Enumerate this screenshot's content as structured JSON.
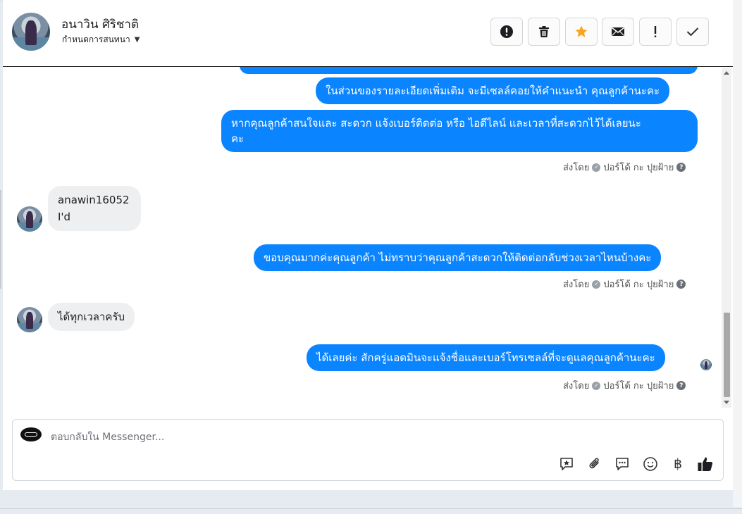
{
  "header": {
    "contact_name": "อนาวิน ศิริชาติ",
    "assign_label": "กำหนดการสนทนา",
    "toolbar": [
      {
        "name": "spam-report-button",
        "icon": "exclamation-circle-icon"
      },
      {
        "name": "delete-button",
        "icon": "trash-icon"
      },
      {
        "name": "star-button",
        "icon": "star-icon"
      },
      {
        "name": "mark-unread-button",
        "icon": "envelope-icon"
      },
      {
        "name": "follow-up-button",
        "icon": "exclamation-icon"
      },
      {
        "name": "mark-done-button",
        "icon": "check-icon"
      }
    ],
    "colors": {
      "star": "#f5a623",
      "text": "#1c1e21"
    }
  },
  "messages": {
    "out1": "ในส่วนของรายละเอียดเพิ่มเติม จะมีเซลล์คอยให้คำแนะนำ คุณลูกค้านะคะ",
    "out2_line1": "หากคุณลูกค้าสนใจและ สะดวก แจ้งเบอร์ติดต่อ หรือ ไอดีไลน์ และเวลาที่สะดวกไว้ได้เลยนะ",
    "out2_line2": "คะ",
    "sent_by_1": "ส่งโดย",
    "sender_1": "ปอร์โด้ กะ ปุยฝ้าย",
    "in1_line1": "anawin16052",
    "in1_line2": "I'd",
    "out3": "ขอบคุณมากค่ะคุณลูกค้า ไม่ทราบว่าคุณลูกค้าสะดวกให้ติดต่อกลับช่วงเวลาไหนบ้างคะ",
    "sent_by_2": "ส่งโดย",
    "sender_2": "ปอร์โด้ กะ ปุยฝ้าย",
    "in2": "ได้ทุกเวลาครับ",
    "out4": "ได้เลยค่ะ สักครู่แอดมินจะแจ้งชื่อและเบอร์โทรเซลล์ที่จะดูแลคุณลูกค้านะคะ",
    "sent_by_3": "ส่งโดย",
    "sender_3": "ปอร์โด้ กะ ปุยฝ้าย",
    "colors": {
      "outgoing": "#0b84ff",
      "incoming": "#eeeff1"
    }
  },
  "composer": {
    "placeholder": "ตอบกลับใน Messenger...",
    "icons": [
      "saved-reply-icon",
      "attachment-icon",
      "chat-bubble-icon",
      "emoji-icon",
      "baht-icon",
      "thumbs-up-icon"
    ]
  }
}
